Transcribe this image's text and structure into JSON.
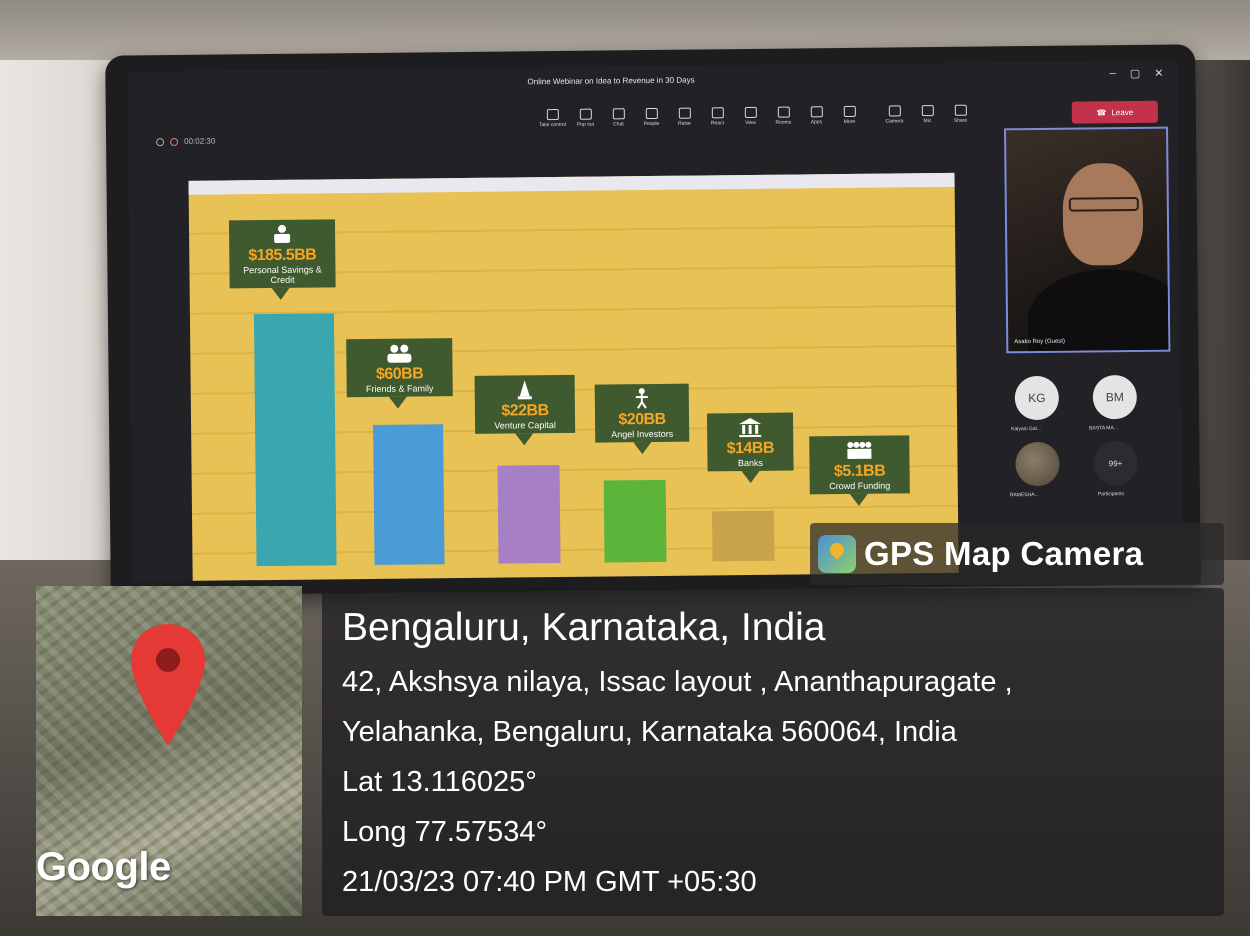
{
  "meeting": {
    "window_title": "Online Webinar on Idea to Revenue in 30 Days",
    "timer": "00:02:30",
    "window_controls": [
      "–",
      "▢",
      "✕"
    ],
    "toolbar": [
      {
        "label": "Take control",
        "icon": "take-control-icon"
      },
      {
        "label": "Pop out",
        "icon": "pop-out-icon"
      },
      {
        "label": "Chat",
        "icon": "chat-icon"
      },
      {
        "label": "People",
        "icon": "people-icon"
      },
      {
        "label": "Raise",
        "icon": "raise-hand-icon"
      },
      {
        "label": "React",
        "icon": "react-icon"
      },
      {
        "label": "View",
        "icon": "view-icon"
      },
      {
        "label": "Rooms",
        "icon": "rooms-icon"
      },
      {
        "label": "Apps",
        "icon": "apps-icon"
      },
      {
        "label": "More",
        "icon": "more-icon"
      },
      {
        "label": "Camera",
        "icon": "camera-icon"
      },
      {
        "label": "Mic",
        "icon": "mic-icon"
      },
      {
        "label": "Share",
        "icon": "share-icon"
      }
    ],
    "leave_label": "Leave",
    "self_view_name": "Asako Roy (Guest)",
    "participants": [
      {
        "initials": "KG",
        "name": "Kalyani Gal..."
      },
      {
        "initials": "BM",
        "name": "BASTA MA..."
      },
      {
        "initials": "",
        "name": "RAMESHA..."
      },
      {
        "initials": "99+",
        "name": "Participants"
      }
    ]
  },
  "slide": {
    "items": [
      {
        "value": "$185.5BB",
        "name": "Personal Savings & Credit",
        "icon": "personal-savings-icon"
      },
      {
        "value": "$60BB",
        "name": "Friends & Family",
        "icon": "friends-family-icon"
      },
      {
        "value": "$22BB",
        "name": "Venture Capital",
        "icon": "venture-capital-icon"
      },
      {
        "value": "$20BB",
        "name": "Angel Investors",
        "icon": "angel-investor-icon"
      },
      {
        "value": "$14BB",
        "name": "Banks",
        "icon": "bank-icon"
      },
      {
        "value": "$5.1BB",
        "name": "Crowd Funding",
        "icon": "crowd-funding-icon"
      }
    ],
    "bar_colors": [
      "#3aa7b0",
      "#4a9bd6",
      "#a67fc4",
      "#5cb53a",
      "#c9a34a",
      "#e8c254"
    ]
  },
  "gps": {
    "app_name": "GPS Map Camera",
    "city": "Bengaluru, Karnataka, India",
    "address_line1": "42, Akshsya nilaya, Issac layout , Ananthapuragate ,",
    "address_line2": "Yelahanka, Bengaluru, Karnataka 560064, India",
    "lat": "Lat 13.116025°",
    "long": "Long 77.57534°",
    "datetime": "21/03/23 07:40 PM GMT +05:30",
    "map_brand": "Google",
    "pin_color": "#e53935"
  }
}
